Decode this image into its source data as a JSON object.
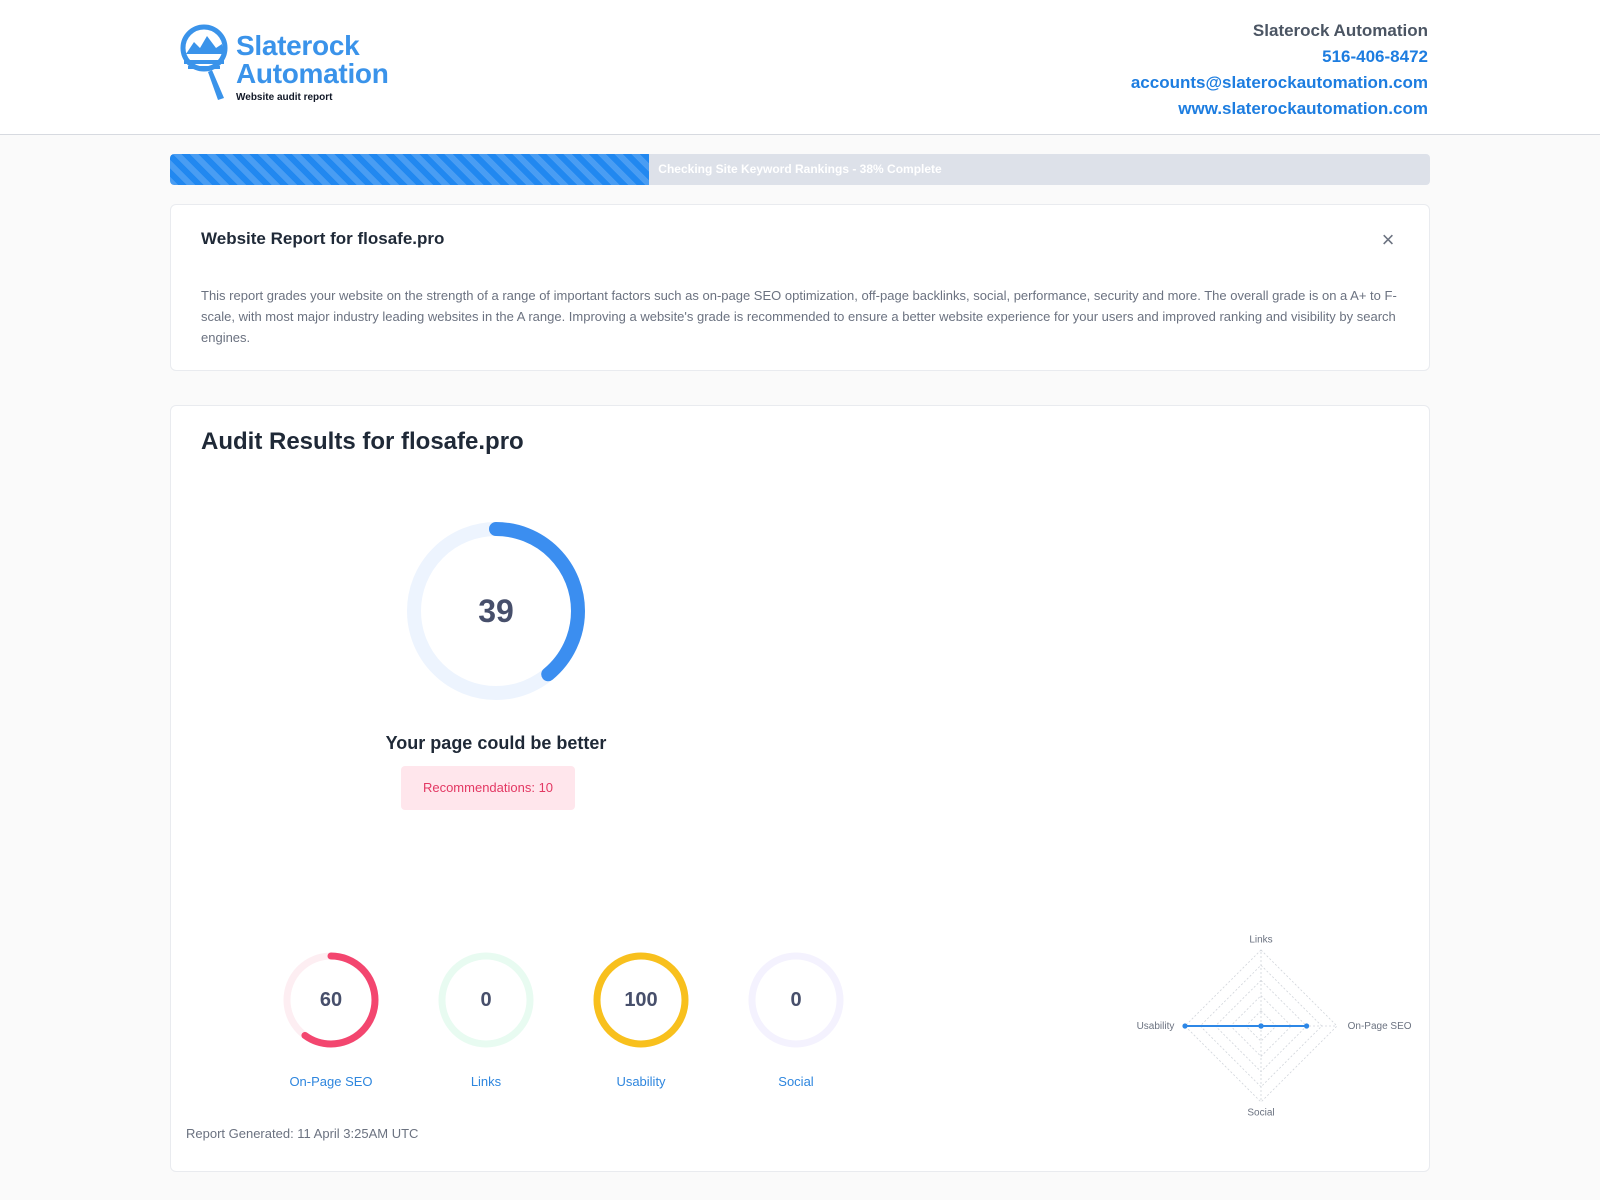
{
  "brand": {
    "name_line1": "Slaterock",
    "name_line2": "Automation",
    "tagline": "Website audit report",
    "accent": "#3a93ea"
  },
  "contact": {
    "company": "Slaterock Automation",
    "phone": "516-406-8472",
    "email": "accounts@slaterockautomation.com",
    "website": "www.slaterockautomation.com"
  },
  "progress": {
    "label": "Checking Site Keyword Rankings - 38% Complete",
    "percent": 38,
    "color": "#2188f0"
  },
  "intro": {
    "title": "Website Report for flosafe.pro",
    "close_icon": "close-icon",
    "description": "This report grades your website on the strength of a range of important factors such as on-page SEO optimization, off-page backlinks, social, performance, security and more. The overall grade is on a A+ to F- scale, with most major industry leading websites in the A range. Improving a website's grade is recommended to ensure a better website experience for your users and improved ranking and visibility by search engines."
  },
  "audit": {
    "title": "Audit Results for flosafe.pro",
    "overall": {
      "score": "39",
      "value": 39,
      "color": "#3b8ef0",
      "track": "#edf4fe"
    },
    "verdict": "Your page could be better",
    "recommendations_label": "Recommendations: 10",
    "categories": [
      {
        "label": "On-Page SEO",
        "score": "60",
        "value": 60,
        "color": "#f3466f",
        "track": "#fdeef2"
      },
      {
        "label": "Links",
        "score": "0",
        "value": 0,
        "color": "#35c08a",
        "track": "#e8fbf1"
      },
      {
        "label": "Usability",
        "score": "100",
        "value": 100,
        "color": "#f8c01d",
        "track": "#fff6d9"
      },
      {
        "label": "Social",
        "score": "0",
        "value": 0,
        "color": "#8b7cf0",
        "track": "#f4f2fe"
      }
    ],
    "radar": {
      "axes": [
        "Links",
        "On-Page SEO",
        "Social",
        "Usability"
      ],
      "values": [
        0,
        60,
        0,
        100
      ],
      "max": 100,
      "color": "#2d87e6"
    },
    "generated": "Report Generated: 11 April 3:25AM UTC"
  }
}
